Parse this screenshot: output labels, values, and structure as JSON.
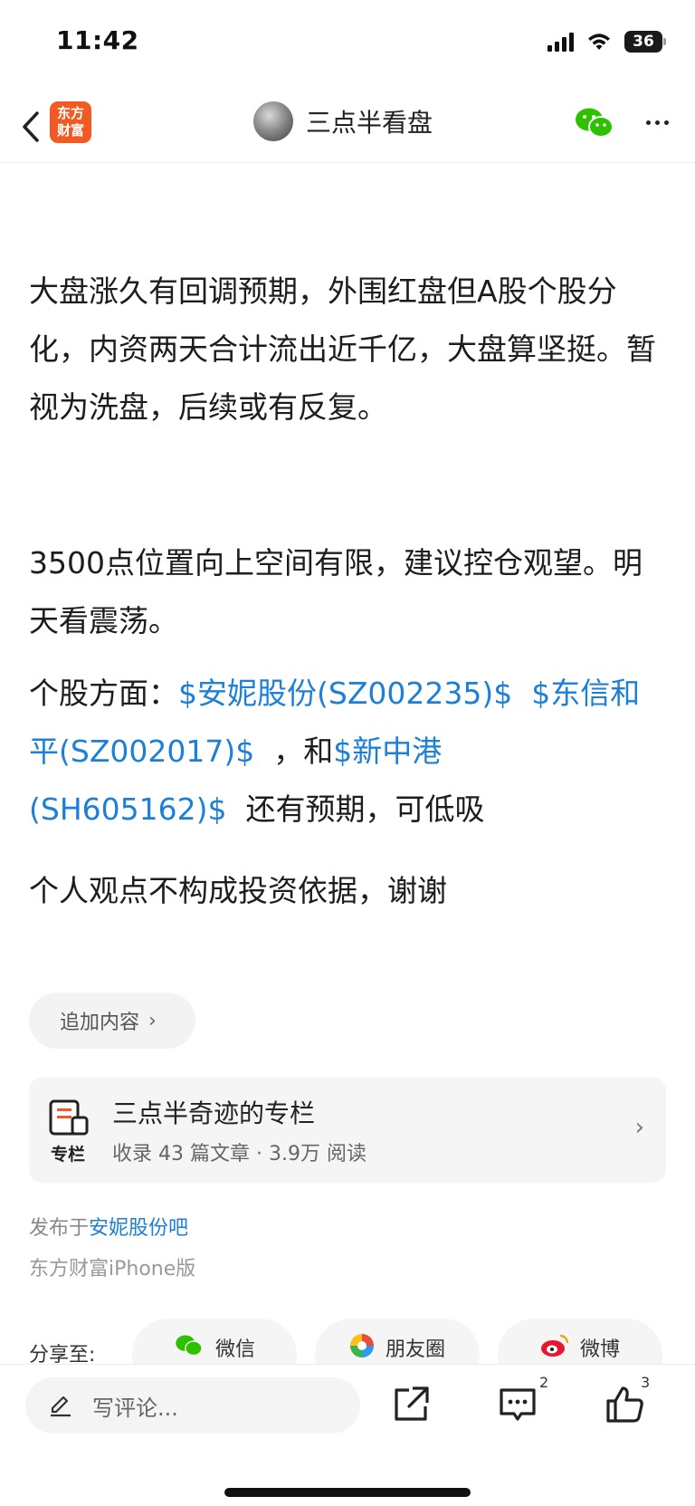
{
  "status_bar": {
    "time": "11:42",
    "battery": "36"
  },
  "nav": {
    "app_logo": "东方\n财富",
    "channel_name": "三点半看盘"
  },
  "article": {
    "p1": "大盘涨久有回调预期，外围红盘但A股个股分化，内资两天合计流出近千亿，大盘算坚挺。暂视为洗盘，后续或有反复。",
    "p2": "3500点位置向上空间有限，建议控仓观望。明天看震荡。",
    "p3_prefix": "个股方面：",
    "stock1": "$安妮股份(SZ002235)$",
    "stock2": "$东信和平(SZ002017)$",
    "p3_mid": "，和",
    "stock3": "$新中港(SH605162)$",
    "p3_suffix": "还有预期，可低吸",
    "p4": "个人观点不构成投资依据，谢谢"
  },
  "add_content": {
    "label": "追加内容"
  },
  "column_card": {
    "icon_label": "专栏",
    "title": "三点半奇迹的专栏",
    "meta": "收录 43 篇文章 · 3.9万 阅读"
  },
  "source": {
    "prefix": "发布于",
    "forum": "安妮股份吧",
    "platform": "东方财富iPhone版"
  },
  "share": {
    "label": "分享至:",
    "wechat": "微信",
    "moments": "朋友圈",
    "weibo": "微博"
  },
  "bottom_bar": {
    "comment_placeholder": "写评论...",
    "comment_count": "2",
    "like_count": "3"
  },
  "colors": {
    "link": "#1c7fd8",
    "brand": "#f15a22",
    "wechat_green": "#2dc100",
    "weibo_red": "#e6162d"
  }
}
